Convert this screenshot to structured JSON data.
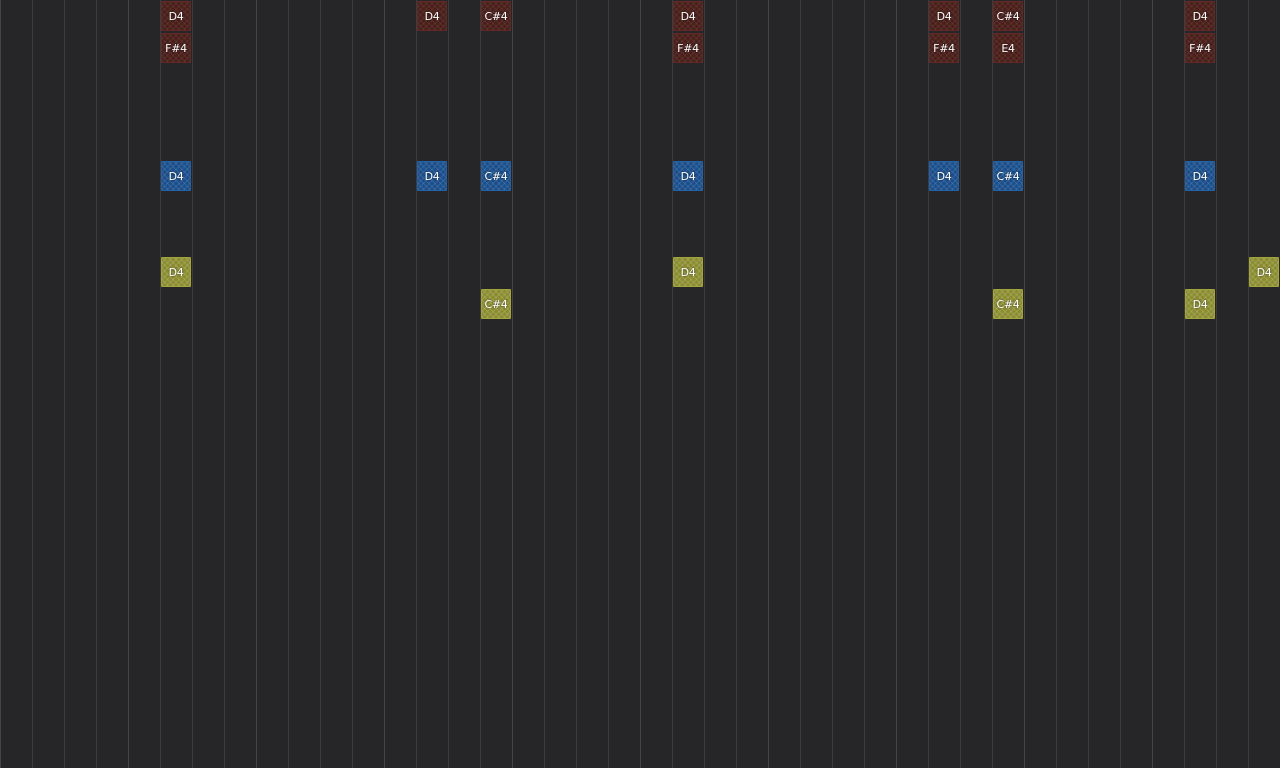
{
  "piano_roll": {
    "colors": {
      "background": "#262628",
      "gridline": "#3c3c3f",
      "track_red": "#4a1f1b",
      "track_blue": "#1a4f8c",
      "track_olive": "#8a8c2e"
    },
    "notes": [
      {
        "label": "D4",
        "color": "red",
        "step": 5,
        "lane": 0
      },
      {
        "label": "F#4",
        "color": "red",
        "step": 5,
        "lane": 1
      },
      {
        "label": "D4",
        "color": "red",
        "step": 13,
        "lane": 0
      },
      {
        "label": "C#4",
        "color": "red",
        "step": 15,
        "lane": 0
      },
      {
        "label": "D4",
        "color": "red",
        "step": 21,
        "lane": 0
      },
      {
        "label": "F#4",
        "color": "red",
        "step": 21,
        "lane": 1
      },
      {
        "label": "D4",
        "color": "red",
        "step": 29,
        "lane": 0
      },
      {
        "label": "F#4",
        "color": "red",
        "step": 29,
        "lane": 1
      },
      {
        "label": "C#4",
        "color": "red",
        "step": 31,
        "lane": 0
      },
      {
        "label": "E4",
        "color": "red",
        "step": 31,
        "lane": 1
      },
      {
        "label": "D4",
        "color": "red",
        "step": 37,
        "lane": 0
      },
      {
        "label": "F#4",
        "color": "red",
        "step": 37,
        "lane": 1
      },
      {
        "label": "D4",
        "color": "blue",
        "step": 5,
        "lane": 5
      },
      {
        "label": "D4",
        "color": "blue",
        "step": 13,
        "lane": 5
      },
      {
        "label": "C#4",
        "color": "blue",
        "step": 15,
        "lane": 5
      },
      {
        "label": "D4",
        "color": "blue",
        "step": 21,
        "lane": 5
      },
      {
        "label": "D4",
        "color": "blue",
        "step": 29,
        "lane": 5
      },
      {
        "label": "C#4",
        "color": "blue",
        "step": 31,
        "lane": 5
      },
      {
        "label": "D4",
        "color": "blue",
        "step": 37,
        "lane": 5
      },
      {
        "label": "D4",
        "color": "olive",
        "step": 5,
        "lane": 8
      },
      {
        "label": "C#4",
        "color": "olive",
        "step": 15,
        "lane": 9
      },
      {
        "label": "D4",
        "color": "olive",
        "step": 21,
        "lane": 8
      },
      {
        "label": "C#4",
        "color": "olive",
        "step": 31,
        "lane": 9
      },
      {
        "label": "D4",
        "color": "olive",
        "step": 37,
        "lane": 9
      },
      {
        "label": "D4",
        "color": "olive",
        "step": 39,
        "lane": 8
      }
    ]
  }
}
